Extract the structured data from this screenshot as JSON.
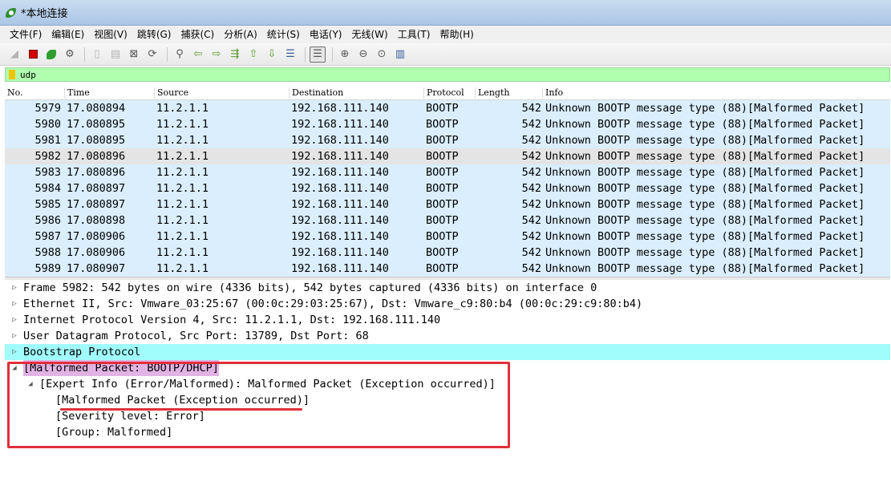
{
  "window": {
    "title": "*本地连接"
  },
  "menu": [
    "文件(F)",
    "编辑(E)",
    "视图(V)",
    "跳转(G)",
    "捕获(C)",
    "分析(A)",
    "统计(S)",
    "电话(Y)",
    "无线(W)",
    "工具(T)",
    "帮助(H)"
  ],
  "toolbar": {
    "icons": [
      "start-capture-icon",
      "stop-capture-icon",
      "restart-capture-icon",
      "capture-options-icon",
      "open-file-icon",
      "save-file-icon",
      "close-file-icon",
      "reload-file-icon",
      "find-packet-icon",
      "go-back-icon",
      "go-forward-icon",
      "go-to-packet-icon",
      "go-first-icon",
      "go-last-icon",
      "auto-scroll-icon",
      "colorize-icon",
      "zoom-in-icon",
      "zoom-out-icon",
      "zoom-normal-icon",
      "resize-columns-icon"
    ]
  },
  "filter": {
    "value": "udp"
  },
  "packet_list": {
    "columns": [
      "No.",
      "Time",
      "Source",
      "Destination",
      "Protocol",
      "Length",
      "Info"
    ],
    "rows": [
      {
        "no": "5979",
        "time": "17.080894",
        "src": "11.2.1.1",
        "dst": "192.168.111.140",
        "proto": "BOOTP",
        "len": "542",
        "info": "Unknown BOOTP message type (88)[Malformed Packet]"
      },
      {
        "no": "5980",
        "time": "17.080895",
        "src": "11.2.1.1",
        "dst": "192.168.111.140",
        "proto": "BOOTP",
        "len": "542",
        "info": "Unknown BOOTP message type (88)[Malformed Packet]"
      },
      {
        "no": "5981",
        "time": "17.080895",
        "src": "11.2.1.1",
        "dst": "192.168.111.140",
        "proto": "BOOTP",
        "len": "542",
        "info": "Unknown BOOTP message type (88)[Malformed Packet]"
      },
      {
        "no": "5982",
        "time": "17.080896",
        "src": "11.2.1.1",
        "dst": "192.168.111.140",
        "proto": "BOOTP",
        "len": "542",
        "info": "Unknown BOOTP message type (88)[Malformed Packet]"
      },
      {
        "no": "5983",
        "time": "17.080896",
        "src": "11.2.1.1",
        "dst": "192.168.111.140",
        "proto": "BOOTP",
        "len": "542",
        "info": "Unknown BOOTP message type (88)[Malformed Packet]"
      },
      {
        "no": "5984",
        "time": "17.080897",
        "src": "11.2.1.1",
        "dst": "192.168.111.140",
        "proto": "BOOTP",
        "len": "542",
        "info": "Unknown BOOTP message type (88)[Malformed Packet]"
      },
      {
        "no": "5985",
        "time": "17.080897",
        "src": "11.2.1.1",
        "dst": "192.168.111.140",
        "proto": "BOOTP",
        "len": "542",
        "info": "Unknown BOOTP message type (88)[Malformed Packet]"
      },
      {
        "no": "5986",
        "time": "17.080898",
        "src": "11.2.1.1",
        "dst": "192.168.111.140",
        "proto": "BOOTP",
        "len": "542",
        "info": "Unknown BOOTP message type (88)[Malformed Packet]"
      },
      {
        "no": "5987",
        "time": "17.080906",
        "src": "11.2.1.1",
        "dst": "192.168.111.140",
        "proto": "BOOTP",
        "len": "542",
        "info": "Unknown BOOTP message type (88)[Malformed Packet]"
      },
      {
        "no": "5988",
        "time": "17.080906",
        "src": "11.2.1.1",
        "dst": "192.168.111.140",
        "proto": "BOOTP",
        "len": "542",
        "info": "Unknown BOOTP message type (88)[Malformed Packet]"
      },
      {
        "no": "5989",
        "time": "17.080907",
        "src": "11.2.1.1",
        "dst": "192.168.111.140",
        "proto": "BOOTP",
        "len": "542",
        "info": "Unknown BOOTP message type (88)[Malformed Packet]"
      }
    ],
    "selected_no": "5982",
    "row_color": "#daeefd",
    "selected_color": "#e4e4e4"
  },
  "details": {
    "rows": [
      {
        "text": "Frame 5982: 542 bytes on wire (4336 bits), 542 bytes captured (4336 bits) on interface 0",
        "arrow": "▷"
      },
      {
        "text": "Ethernet II, Src: Vmware_03:25:67 (00:0c:29:03:25:67), Dst: Vmware_c9:80:b4 (00:0c:29:c9:80:b4)",
        "arrow": "▷"
      },
      {
        "text": "Internet Protocol Version 4, Src: 11.2.1.1, Dst: 192.168.111.140",
        "arrow": "▷"
      },
      {
        "text": "User Datagram Protocol, Src Port: 13789, Dst Port: 68",
        "arrow": "▷"
      },
      {
        "text": "Bootstrap Protocol",
        "arrow": "▷"
      },
      {
        "text": "[Malformed Packet: BOOTP/DHCP]",
        "arrow": "◢"
      },
      {
        "text": "[Expert Info (Error/Malformed): Malformed Packet (Exception occurred)]",
        "arrow": "◢"
      },
      {
        "text": "[Malformed Packet (Exception occurred)]"
      },
      {
        "text": "[Severity level: Error]"
      },
      {
        "text": "[Group: Malformed]"
      }
    ],
    "bootp_highlight": "#a1fcfc",
    "malformed_highlight": "#e1b3e4"
  },
  "annotation_color": "#e0303a"
}
